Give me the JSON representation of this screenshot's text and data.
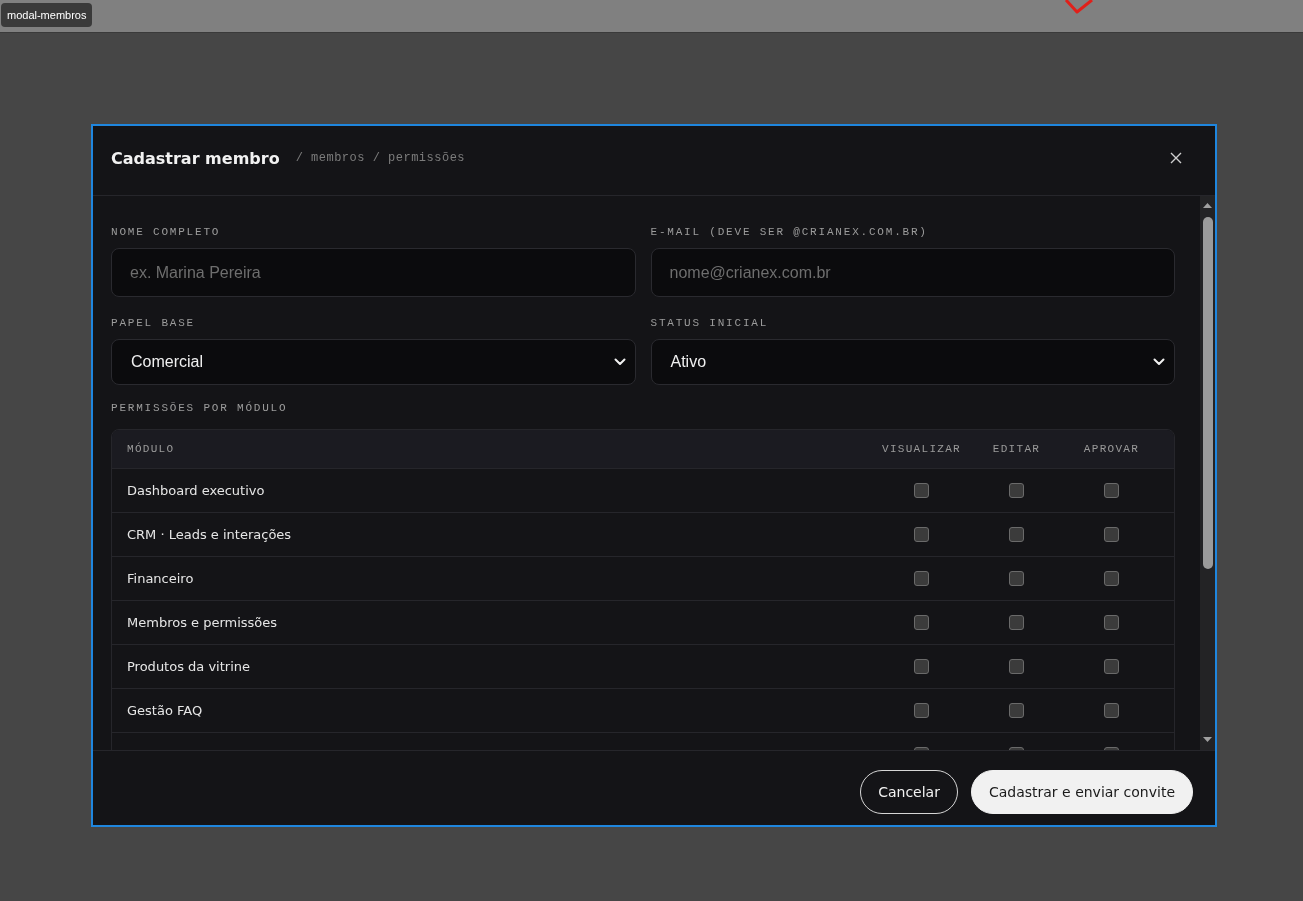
{
  "frame_label": "modal-membros",
  "modal": {
    "title": "Cadastrar membro",
    "breadcrumb": "/ membros / permissões",
    "fields": [
      {
        "kind": "input",
        "label": "NOME COMPLETO",
        "placeholder": "ex. Marina Pereira"
      },
      {
        "kind": "input",
        "label": "E-MAIL (DEVE SER @CRIANEX.COM.BR)",
        "placeholder": "nome@crianex.com.br"
      },
      {
        "kind": "select",
        "label": "PAPEL BASE",
        "value": "Comercial"
      },
      {
        "kind": "select",
        "label": "STATUS INICIAL",
        "value": "Ativo"
      }
    ],
    "permissions": {
      "label": "PERMISSÕES POR MÓDULO",
      "columns": [
        "MÓDULO",
        "VISUALIZAR",
        "EDITAR",
        "APROVAR"
      ],
      "rows": [
        {
          "module": "Dashboard executivo",
          "checks": [
            {
              "checked": false
            },
            {
              "checked": false
            },
            {
              "checked": false
            }
          ]
        },
        {
          "module": "CRM · Leads e interações",
          "checks": [
            {
              "checked": false
            },
            {
              "checked": false
            },
            {
              "checked": false
            }
          ]
        },
        {
          "module": "Financeiro",
          "checks": [
            {
              "checked": false
            },
            {
              "checked": false
            },
            {
              "checked": false
            }
          ]
        },
        {
          "module": "Membros e permissões",
          "checks": [
            {
              "checked": false
            },
            {
              "checked": false
            },
            {
              "checked": false
            }
          ]
        },
        {
          "module": "Produtos da vitrine",
          "checks": [
            {
              "checked": false
            },
            {
              "checked": false
            },
            {
              "checked": false
            }
          ]
        },
        {
          "module": "Gestão FAQ",
          "checks": [
            {
              "checked": false
            },
            {
              "checked": false
            },
            {
              "checked": false
            }
          ]
        },
        {
          "checks": [
            {
              "checked": false
            },
            {
              "checked": false
            },
            {
              "checked": false
            }
          ]
        }
      ]
    },
    "buttons": [
      {
        "kind": "secondary",
        "label": "Cancelar"
      },
      {
        "kind": "primary",
        "label": "Cadastrar e enviar convite"
      }
    ]
  }
}
